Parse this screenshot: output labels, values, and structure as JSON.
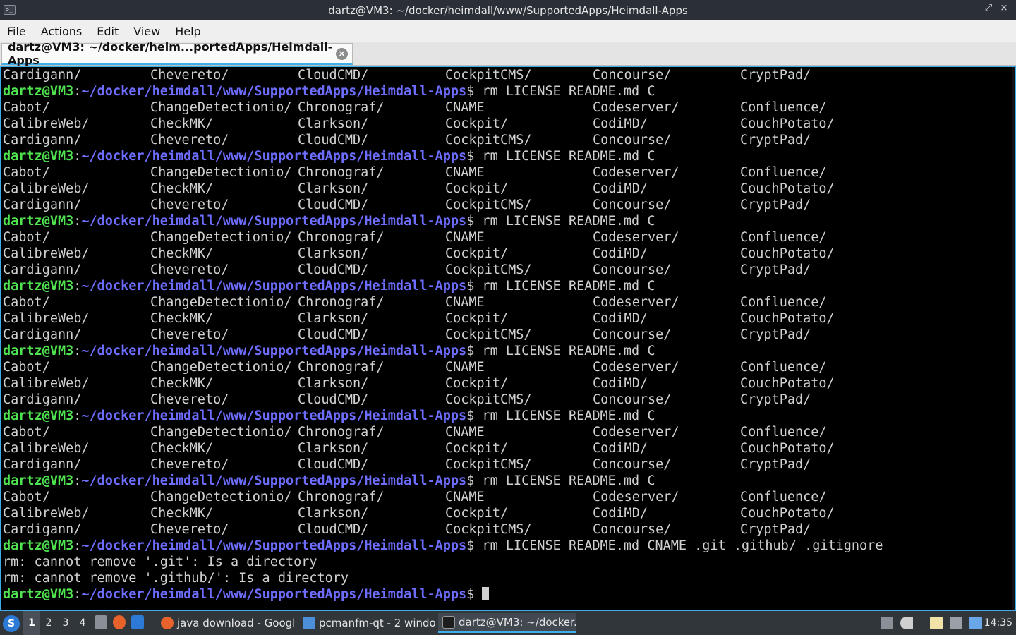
{
  "window": {
    "title": "dartz@VM3: ~/docker/heimdall/www/SupportedApps/Heimdall-Apps",
    "controls": {
      "minimize": "–",
      "maximize": "⤢",
      "close": "×"
    }
  },
  "menubar": {
    "items": [
      "File",
      "Actions",
      "Edit",
      "View",
      "Help"
    ]
  },
  "tab": {
    "label": "dartz@VM3: ~/docker/heim...portedApps/Heimdall-Apps",
    "close": "×"
  },
  "terminal": {
    "prompt": {
      "user": "dartz@VM3",
      "colon": ":",
      "path": "~/docker/heimdall/www/SupportedApps/Heimdall-Apps",
      "dollar": "$"
    },
    "first_line": [
      "Cardigann/",
      "Chevereto/",
      "CloudCMD/",
      "CockpitCMS/",
      "Concourse/",
      "CryptPad/"
    ],
    "repeat_command": " rm LICENSE README.md C",
    "listing": [
      [
        "Cabot/",
        "ChangeDetectionio/",
        "Chronograf/",
        "CNAME",
        "Codeserver/",
        "Confluence/"
      ],
      [
        "CalibreWeb/",
        "CheckMK/",
        "Clarkson/",
        "Cockpit/",
        "CodiMD/",
        "CouchPotato/"
      ],
      [
        "Cardigann/",
        "Chevereto/",
        "CloudCMD/",
        "CockpitCMS/",
        "Concourse/",
        "CryptPad/"
      ]
    ],
    "final_command": " rm LICENSE README.md CNAME .git .github/ .gitignore",
    "errors": [
      "rm: cannot remove '.git': Is a directory",
      "rm: cannot remove '.github/': Is a directory"
    ]
  },
  "taskbar": {
    "desktops": [
      "1",
      "2",
      "3",
      "4"
    ],
    "tasks": [
      {
        "label": "java download - Googl...",
        "icon": "firefox-icon"
      },
      {
        "label": "pcmanfm-qt - 2 windo...",
        "icon": "folder-icon"
      },
      {
        "label": "dartz@VM3: ~/docker...",
        "icon": "terminal-icon"
      }
    ],
    "clock": "14:35"
  }
}
